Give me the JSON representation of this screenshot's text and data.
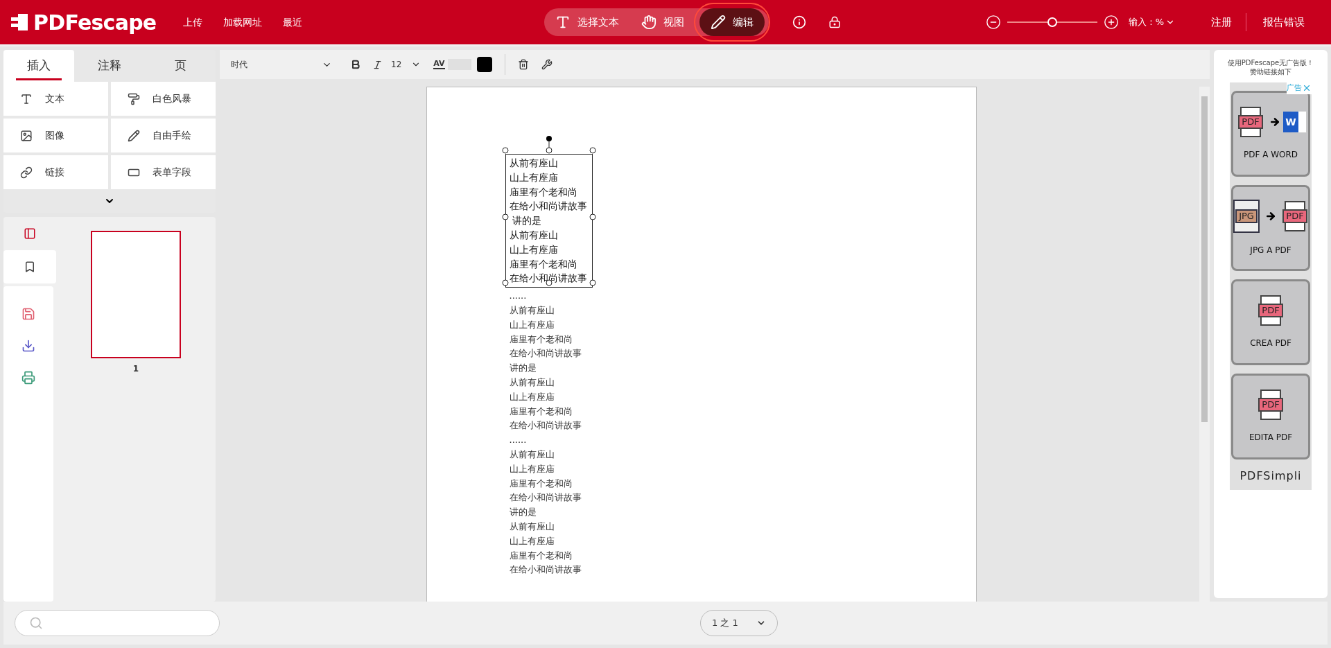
{
  "header": {
    "logo": "PDFescape",
    "nav": [
      "上传",
      "加载网址",
      "最近"
    ],
    "modes": [
      {
        "label": "选择文本",
        "selected": false
      },
      {
        "label": "视图",
        "selected": false
      },
      {
        "label": "编辑",
        "selected": true
      }
    ],
    "zoom": {
      "level": 0.5,
      "input_label": "输入：%"
    },
    "register": "注册",
    "report": "报告错误"
  },
  "sidebar": {
    "tabs": [
      {
        "label": "插入",
        "selected": true
      },
      {
        "label": "注释",
        "selected": false
      },
      {
        "label": "页",
        "selected": false
      }
    ],
    "tools": [
      "文本",
      "白色风暴",
      "图像",
      "自由手绘",
      "链接",
      "表单字段"
    ],
    "views": [
      {
        "selected": true
      },
      {
        "selected": false
      }
    ],
    "pages": [
      {
        "number": "1",
        "selected": true
      }
    ]
  },
  "toolbar": {
    "font": "时代",
    "size": "12",
    "spacing_label": "AV",
    "color": "#000000"
  },
  "document": {
    "selected_box": [
      "从前有座山",
      "山上有座庙",
      "庙里有个老和尚",
      "在给小和尚讲故事",
      " 讲的是",
      "从前有座山",
      "山上有座庙",
      "庙里有个老和尚",
      "在给小和尚讲故事"
    ],
    "lines": [
      "......",
      "从前有座山",
      "山上有座庙",
      "庙里有个老和尚",
      "在给小和尚讲故事",
      "讲的是",
      "从前有座山",
      "山上有座庙",
      "庙里有个老和尚",
      "在给小和尚讲故事",
      "......",
      "从前有座山",
      "山上有座庙",
      "庙里有个老和尚",
      "在给小和尚讲故事",
      "讲的是",
      "从前有座山",
      "山上有座庙",
      "庙里有个老和尚",
      "在给小和尚讲故事"
    ]
  },
  "ad": {
    "intro": [
      "使用PDFescape无广告版！",
      "赞助链接如下"
    ],
    "badge": "广告",
    "cards": [
      {
        "label": "PDF A WORD",
        "icons": [
          {
            "kind": "doc",
            "label": "PDF"
          },
          {
            "kind": "word",
            "label": "W"
          }
        ]
      },
      {
        "label": "JPG A PDF",
        "icons": [
          {
            "kind": "jpg",
            "label": "JPG"
          },
          {
            "kind": "doc",
            "label": "PDF"
          }
        ]
      },
      {
        "label": "CREA PDF",
        "icons": [
          {
            "kind": "doc",
            "label": "PDF"
          }
        ]
      },
      {
        "label": "EDITA PDF",
        "icons": [
          {
            "kind": "doc",
            "label": "PDF"
          }
        ]
      }
    ],
    "brand": "PDFSimpli"
  },
  "footer": {
    "page_select": "1 之 1"
  }
}
